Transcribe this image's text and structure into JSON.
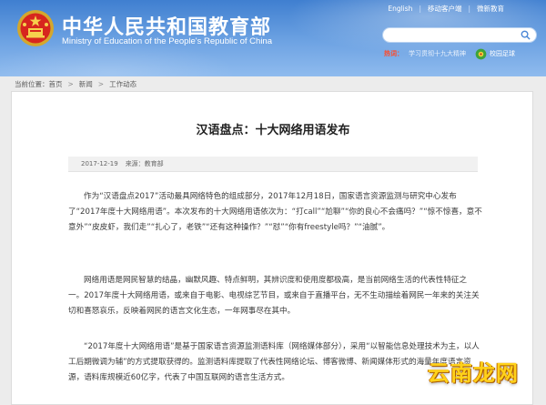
{
  "header": {
    "title_cn": "中华人民共和国教育部",
    "title_en": "Ministry of Education of the People's Republic of China",
    "links": [
      "English",
      "移动客户端",
      "微新教育"
    ],
    "hot_label": "热词：",
    "hot_text": "学习贯彻十九大精神",
    "campus_label": "校园足球"
  },
  "breadcrumb": {
    "prefix": "当前位置：",
    "items": [
      "首页",
      "新闻",
      "工作动态"
    ],
    "separator": ">"
  },
  "article": {
    "title": "汉语盘点：十大网络用语发布",
    "date": "2017-12-19",
    "source": "来源：教育部",
    "paragraphs": [
      "作为“汉语盘点2017”活动最具网络特色的组成部分，2017年12月18日，国家语言资源监测与研究中心发布了“2017年度十大网络用语”。本次发布的十大网络用语依次为：“打call”“尬聊”“你的良心不会痛吗？”“惊不惊喜，意不意外”“皮皮虾，我们走”“扎心了，老铁”“还有这种操作？”“怼”“你有freestyle吗？”“油腻”。",
      "网络用语是网民智慧的结晶，幽默风趣、特点鲜明，其辨识度和使用度都极高，是当前网络生活的代表性特征之一。2017年度十大网络用语，或来自于电影、电视综艺节目，或来自于直播平台，无不生动描绘着网民一年来的关注关切和喜怒哀乐，反映着网民的语言文化生态，一年网事尽在其中。",
      "“2017年度十大网络用语”是基于国家语言资源监测语料库（网络媒体部分），采用“以智能信息处理技术为主，以人工后期微调为辅”的方式提取获得的。监测语料库提取了代表性网络论坛、博客微博、新闻媒体形式的海量年度语言资源，语料库规模近60亿字，代表了中国互联网的语言生活方式。"
    ]
  },
  "watermark": "云南龙网",
  "colors": {
    "header_blue": "#4a86d6",
    "hot_red": "#ff4a2a",
    "watermark_yellow": "#ffd21a"
  }
}
